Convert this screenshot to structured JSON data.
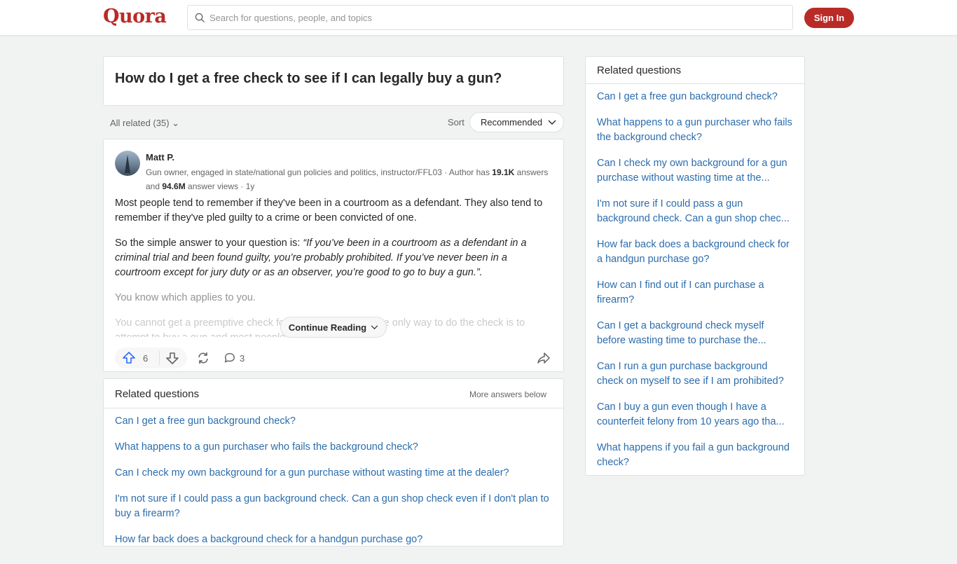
{
  "header": {
    "logo": "Quora",
    "search_placeholder": "Search for questions, people, and topics",
    "signin": "Sign In"
  },
  "question": {
    "title": "How do I get a free check to see if I can legally buy a gun?"
  },
  "filters": {
    "all_related": "All related (35)",
    "sort_label": "Sort",
    "sort_value": "Recommended"
  },
  "answer": {
    "author": "Matt P.",
    "cred_text": "Gun owner, engaged in state/national gun policies and politics, instructor/FFL03 · Author has ",
    "answers_count": "19.1K",
    "answers_and": " answers and ",
    "views_count": "94.6M",
    "views_suffix": " answer views · 1y",
    "p1": "Most people tend to remember if they've been in a courtroom as a defendant. They also tend to remember if they've pled guilty to a crime or been convicted of one.",
    "p2_prefix": "So the simple answer to your question is: ",
    "p2_quote": "“If you’ve been in a courtroom as a defendant in a criminal trial and been found guilty, you’re probably prohibited. If you’ve never been in a courtroom except for jury duty or as an observer, you’re good to go to buy a gun.”.",
    "p3": "You know which applies to you.",
    "p4": "You cannot get a preemptive check for free or otherwise. The only way to do the check is to attempt to buy a gun and most people know bef",
    "continue": "Continue Reading",
    "upvotes": "6",
    "comments": "3"
  },
  "related_main": {
    "title": "Related questions",
    "more": "More answers below",
    "items": [
      "Can I get a free gun background check?",
      "What happens to a gun purchaser who fails the background check?",
      "Can I check my own background for a gun purchase without wasting time at the dealer?",
      "I'm not sure if I could pass a gun background check. Can a gun shop check even if I don't plan to buy a firearm?",
      "How far back does a background check for a handgun purchase go?"
    ]
  },
  "related_side": {
    "title": "Related questions",
    "items": [
      "Can I get a free gun background check?",
      "What happens to a gun purchaser who fails the background check?",
      "Can I check my own background for a gun purchase without wasting time at the...",
      "I'm not sure if I could pass a gun background check. Can a gun shop chec...",
      "How far back does a background check for a handgun purchase go?",
      "How can I find out if I can purchase a firearm?",
      "Can I get a background check myself before wasting time to purchase the...",
      "Can I run a gun purchase background check on myself to see if I am prohibited?",
      "Can I buy a gun even though I have a counterfeit felony from 10 years ago tha...",
      "What happens if you fail a gun background check?"
    ]
  }
}
